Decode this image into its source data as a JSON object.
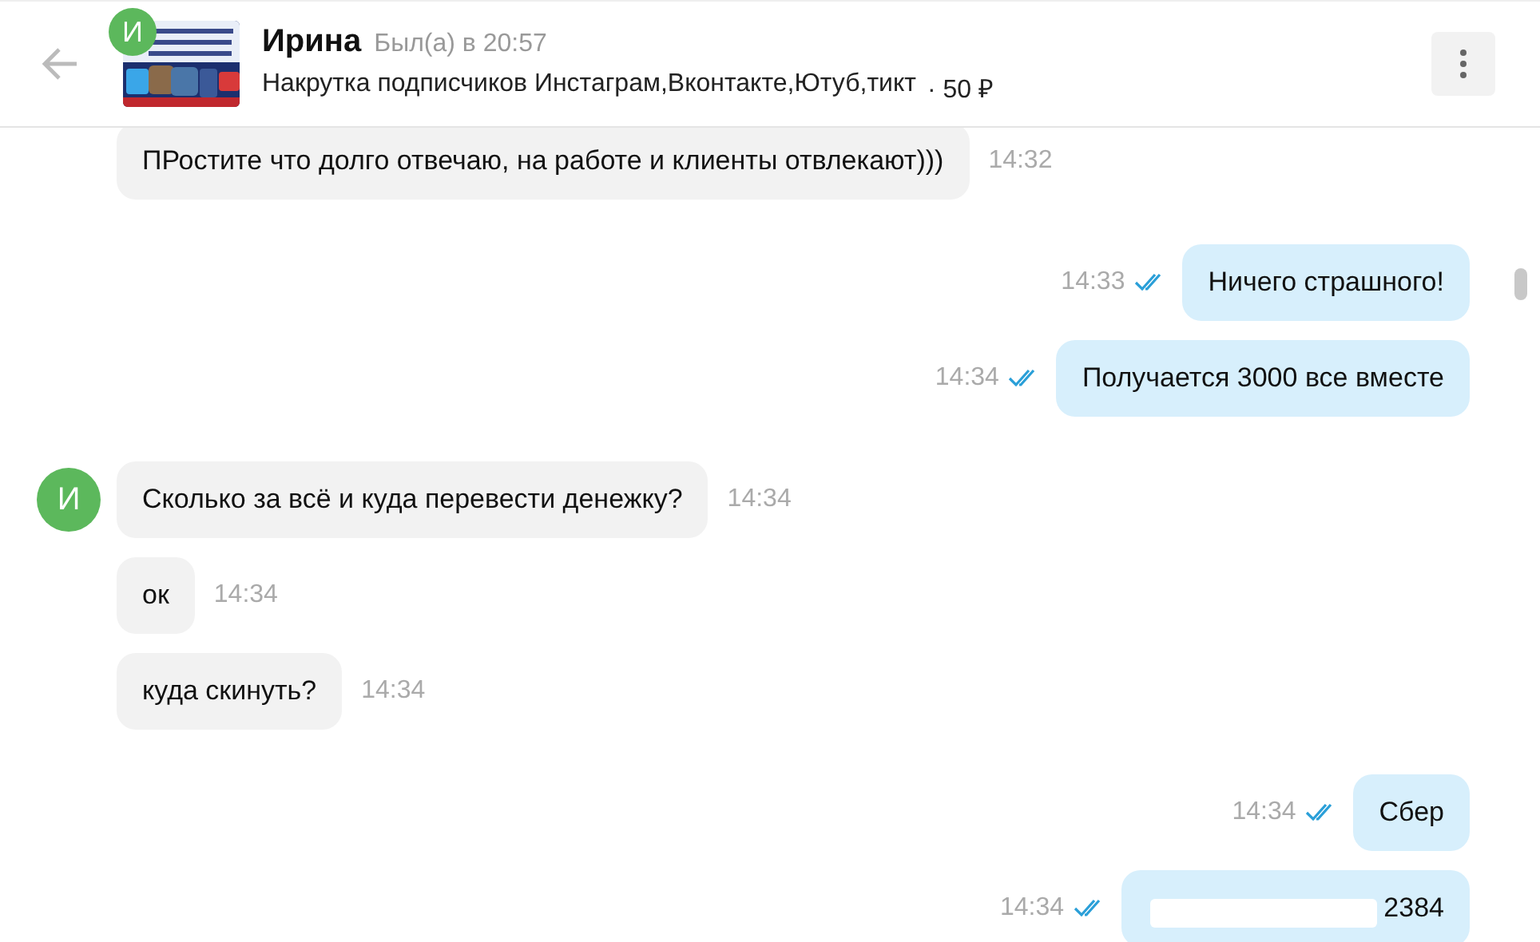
{
  "header": {
    "contact_initial": "И",
    "name": "Ирина",
    "status": "Был(а) в 20:57",
    "listing": "Накрутка подписчиков Инстаграм,Вконтакте,Ютуб,тикт",
    "price": "· 50 ₽"
  },
  "messages": [
    {
      "kind": "incoming",
      "text": "ПРостите что долго отвечаю, на работе и клиенты отвлекают)))",
      "time": "14:32"
    },
    {
      "kind": "outgoing",
      "text": "Ничего страшного!",
      "time": "14:33",
      "read": true
    },
    {
      "kind": "outgoing",
      "text": "Получается 3000 все вместе",
      "time": "14:34",
      "read": true
    },
    {
      "kind": "incoming",
      "text": "Сколько за всё и куда перевести денежку?",
      "time": "14:34",
      "avatar": "И"
    },
    {
      "kind": "incoming",
      "text": "ок",
      "time": "14:34"
    },
    {
      "kind": "incoming",
      "text": "куда скинуть?",
      "time": "14:34"
    },
    {
      "kind": "outgoing",
      "text": "Сбер",
      "time": "14:34",
      "read": true
    },
    {
      "kind": "outgoing",
      "text": "2384",
      "time": "14:34",
      "read": true,
      "redacted": true
    }
  ]
}
